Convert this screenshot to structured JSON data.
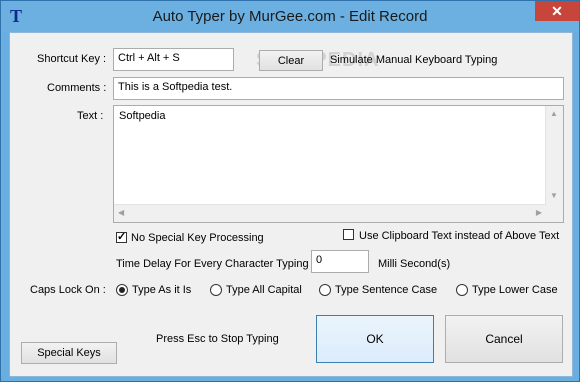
{
  "window": {
    "title": "Auto Typer by MurGee.com - Edit Record",
    "app_icon_glyph": "T",
    "close_glyph": "✕"
  },
  "watermark": "SOFTPEDIA",
  "form": {
    "shortcut_label": "Shortcut Key :",
    "shortcut_value": "Ctrl + Alt + S",
    "clear_label": "Clear",
    "simulate_label": "Simulate Manual Keyboard Typing",
    "comments_label": "Comments :",
    "comments_value": "This is a Softpedia test.",
    "text_label": "Text :",
    "text_value": "Softpedia",
    "no_special_label": "No Special Key Processing",
    "no_special_checked": true,
    "clipboard_label": "Use Clipboard Text instead of Above Text",
    "clipboard_checked": false,
    "delay_label": "Time Delay For Every Character Typing :",
    "delay_value": "0",
    "delay_unit": "Milli Second(s)",
    "caps_label": "Caps Lock On :",
    "caps_options": [
      {
        "label": "Type As it Is",
        "selected": true
      },
      {
        "label": "Type All Capital",
        "selected": false
      },
      {
        "label": "Type Sentence Case",
        "selected": false
      },
      {
        "label": "Type Lower Case",
        "selected": false
      }
    ],
    "esc_hint": "Press Esc to Stop Typing",
    "ok_label": "OK",
    "cancel_label": "Cancel",
    "special_keys_label": "Special Keys"
  },
  "icons": [
    "app-icon",
    "close-icon",
    "scroll-up-arrow-icon",
    "scroll-down-arrow-icon",
    "scroll-left-arrow-icon",
    "scroll-right-arrow-icon"
  ]
}
